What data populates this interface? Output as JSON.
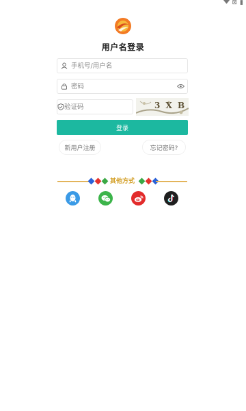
{
  "status_bar": {
    "signal": "⊠",
    "battery": "▮"
  },
  "header": {
    "title": "用户名登录"
  },
  "form": {
    "username_placeholder": "手机号/用户名",
    "password_placeholder": "密码",
    "captcha_placeholder": "验证码",
    "captcha_text": "3 X B",
    "login_label": "登录"
  },
  "links": {
    "register_label": "新用户注册",
    "forgot_label": "忘记密码?"
  },
  "other": {
    "label": "其他方式",
    "diamond_colors": [
      "#2a62d8",
      "#e5322d",
      "#3aa845"
    ],
    "social": [
      "qq-icon",
      "wechat-icon",
      "weibo-icon",
      "tiktok-icon"
    ]
  },
  "colors": {
    "accent": "#1cb8a0",
    "divider": "#e3b45b",
    "other_label": "#d4a12b"
  }
}
